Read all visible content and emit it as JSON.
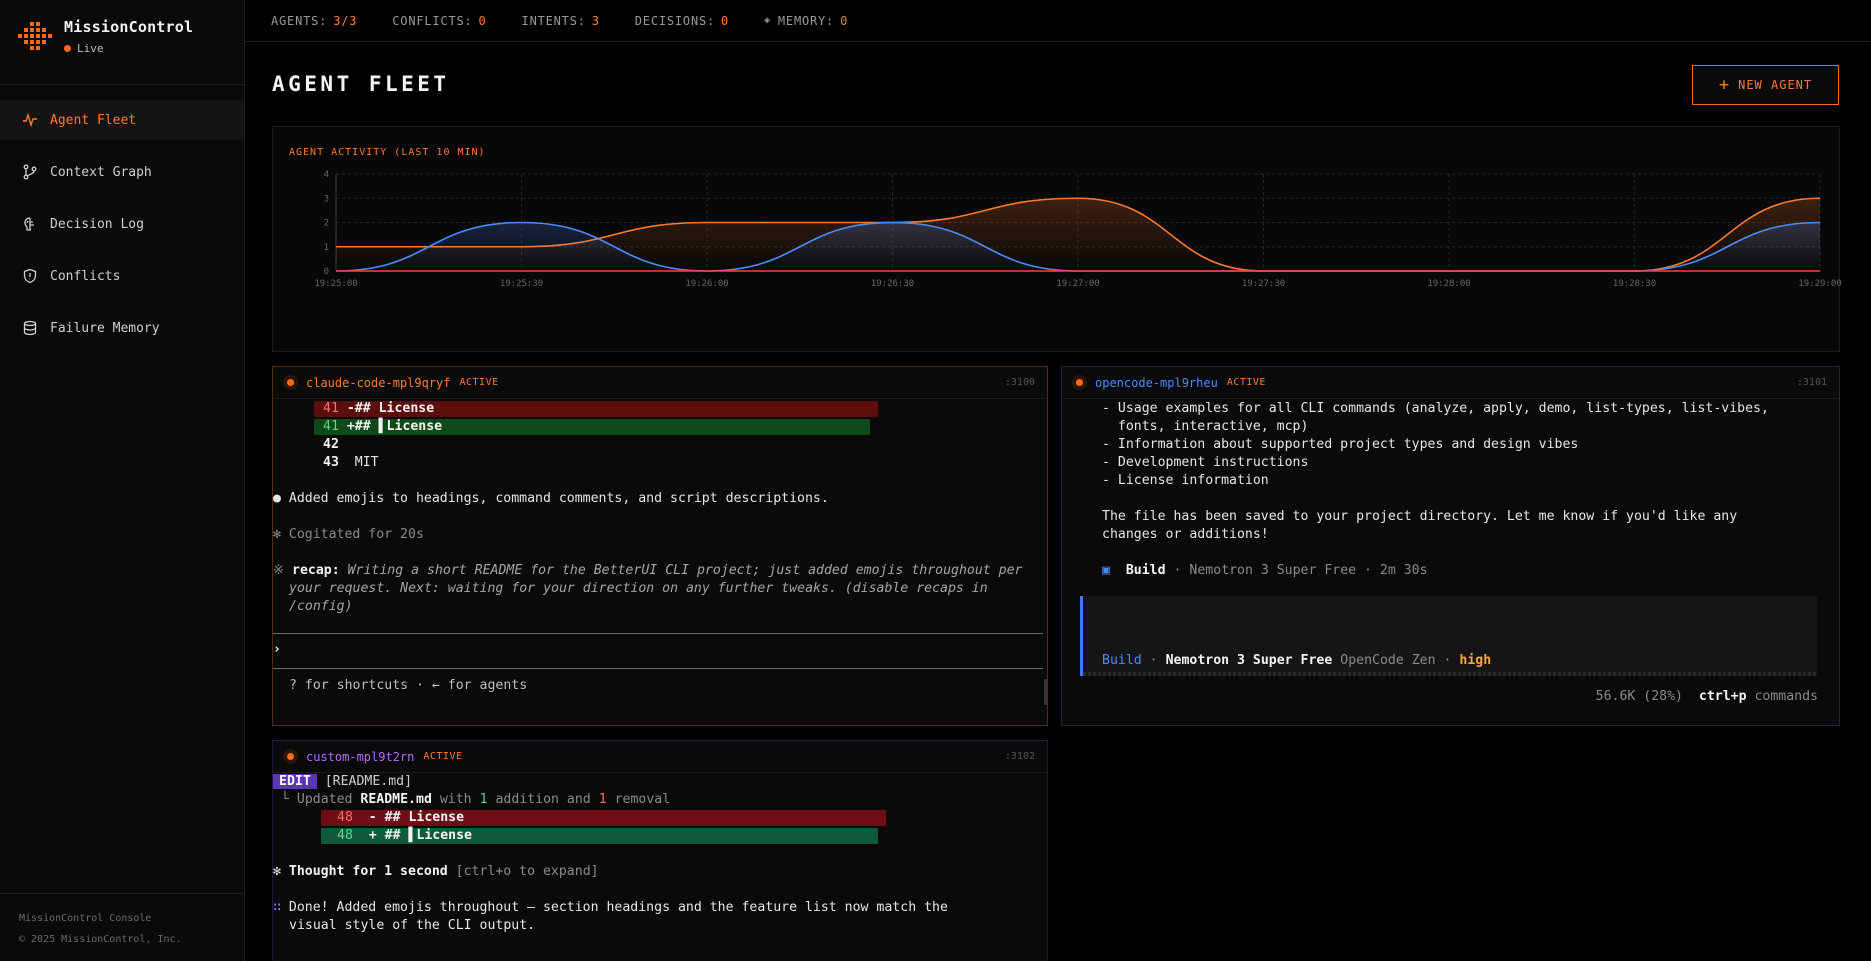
{
  "brand": {
    "name": "MissionControl",
    "status": "Live"
  },
  "nav": {
    "items": [
      {
        "label": "Agent Fleet",
        "icon": "activity-icon",
        "active": true
      },
      {
        "label": "Context Graph",
        "icon": "git-branch-icon",
        "active": false
      },
      {
        "label": "Decision Log",
        "icon": "brain-icon",
        "active": false
      },
      {
        "label": "Conflicts",
        "icon": "shield-icon",
        "active": false
      },
      {
        "label": "Failure Memory",
        "icon": "database-icon",
        "active": false
      }
    ]
  },
  "footer": {
    "line1": "MissionControl Console",
    "line2": "© 2025 MissionControl, Inc."
  },
  "topbar": {
    "agents_label": "AGENTS:",
    "agents_value": "3/3",
    "conflicts_label": "CONFLICTS:",
    "conflicts_value": "0",
    "intents_label": "INTENTS:",
    "intents_value": "3",
    "decisions_label": "DECISIONS:",
    "decisions_value": "0",
    "memory_icon": "◈",
    "memory_label": "MEMORY:",
    "memory_value": "0"
  },
  "page": {
    "title": "AGENT FLEET",
    "new_agent_label": "NEW AGENT"
  },
  "colors": {
    "accent": "#ff6a1a",
    "blue_series": "#4a8cff",
    "orange_series": "#ff7a2e",
    "red_series": "#ff3d3d",
    "purple_agent": "#b36bff"
  },
  "chart_data": {
    "type": "line",
    "title": "AGENT ACTIVITY (LAST 10 MIN)",
    "categories": [
      "19:25:00",
      "19:25:30",
      "19:26:00",
      "19:26:30",
      "19:27:00",
      "19:27:30",
      "19:28:00",
      "19:28:30",
      "19:29:00"
    ],
    "ylim": [
      0,
      4
    ],
    "yticks": [
      "0",
      "1",
      "2",
      "3",
      "4"
    ],
    "grid": true,
    "series": [
      {
        "color": "#ff7a2e",
        "points": [
          [
            0,
            1
          ],
          [
            0.5,
            1
          ],
          [
            1,
            2
          ],
          [
            1.5,
            2
          ],
          [
            2,
            3
          ],
          [
            2.5,
            0
          ],
          [
            3,
            0
          ],
          [
            3.5,
            0
          ],
          [
            4,
            3
          ]
        ]
      },
      {
        "color": "#4a8cff",
        "points": [
          [
            0,
            0
          ],
          [
            0.5,
            2
          ],
          [
            1,
            0
          ],
          [
            1.5,
            2
          ],
          [
            2,
            0
          ],
          [
            2.5,
            0
          ],
          [
            3,
            0
          ],
          [
            3.5,
            0
          ],
          [
            4,
            2
          ]
        ]
      },
      {
        "color": "#ff3d3d",
        "points": [
          [
            0,
            0
          ],
          [
            0.5,
            0
          ],
          [
            1,
            0
          ],
          [
            1.5,
            0
          ],
          [
            2,
            0
          ],
          [
            2.5,
            0
          ],
          [
            3,
            0
          ],
          [
            3.5,
            0
          ],
          [
            4,
            0
          ]
        ]
      }
    ]
  },
  "agents": [
    {
      "name": "claude-code-mpl9qryf",
      "status": "ACTIVE",
      "port": ":3100",
      "lines": {
        "l1_num": "41",
        "l1_text": "-## License",
        "l2_num": "41",
        "l2_text": "+## ▌License",
        "l3_num": "42",
        "l4_num": "43",
        "l4_text": "MIT",
        "bullet": "●",
        "added": "Added emojis to headings, command comments, and script descriptions.",
        "cogitated_icon": "✻",
        "cogitated": "Cogitated for 20s",
        "recap_icon": "※",
        "recap_label": "recap:",
        "recap_1": "Writing a short README for the BetterUI CLI project; just added emojis throughout per",
        "recap_2": "your request. Next: waiting for your direction on any further tweaks. (disable recaps in",
        "recap_3": "/config)",
        "prompt": "›",
        "hint": "? for shortcuts · ← for agents"
      }
    },
    {
      "name": "opencode-mpl9rheu",
      "status": "ACTIVE",
      "port": ":3101",
      "lines": {
        "u1a": "- Usage examples for all CLI commands (analyze, apply, demo, list-types, list-vibes,",
        "u1b": "  fonts, interactive, mcp)",
        "u2": "- Information about supported project types and design vibes",
        "u3": "- Development instructions",
        "u4": "- License information",
        "saved_1": "The file has been saved to your project directory. Let me know if you'd like any",
        "saved_2": "changes or additions!",
        "build_icon": "▣",
        "build_label": "Build",
        "build_meta": "· Nemotron 3 Super Free · 2m 30s",
        "mode_build": "Build",
        "mode_sep1": "·",
        "mode_model": "Nemotron 3 Super Free",
        "mode_provider": "OpenCode Zen",
        "mode_sep2": "·",
        "mode_effort": "high",
        "tokens": "56.6K (28%)",
        "cmd_key": "ctrl+p",
        "cmd_label": "commands"
      }
    },
    {
      "name": "custom-mpl9t2rn",
      "status": "ACTIVE",
      "port": ":3102",
      "lines": {
        "edit_tag": "EDIT",
        "edit_file": "[README.md]",
        "updated_prefix": "└ Updated",
        "updated_file": "README.md",
        "updated_with": "with",
        "updated_add": "1",
        "updated_mid": "addition and",
        "updated_rem": "1",
        "updated_suffix": "removal",
        "d1_num": "48",
        "d1_text": "- ## License",
        "d2_num": "48",
        "d2_text": "+ ## ▌License",
        "thought_icon": "✻",
        "thought": "Thought for 1 second",
        "thought_hint": "[ctrl+o to expand]",
        "done_icon": "∷",
        "done_1": "Done! Added emojis throughout — section headings and the feature list now match the",
        "done_2": "visual style of the CLI output."
      }
    }
  ]
}
